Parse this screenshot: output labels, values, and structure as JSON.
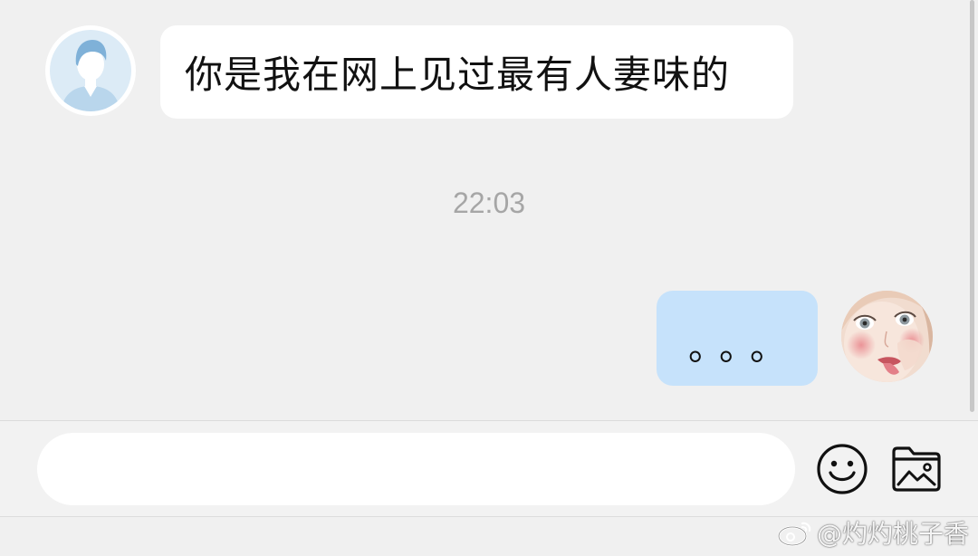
{
  "chat": {
    "messages": [
      {
        "direction": "incoming",
        "text": "你是我在网上见过最有人妻味的",
        "avatar": "default-person-icon"
      },
      {
        "direction": "outgoing",
        "text": "。。。",
        "avatar": "user-avatar-photo"
      }
    ],
    "timestamp": "22:03"
  },
  "input": {
    "value": "",
    "placeholder": ""
  },
  "toolbar": {
    "icons": [
      "emoji-icon",
      "image-folder-icon"
    ]
  },
  "watermark": {
    "text": "@灼灼桃子香"
  },
  "colors": {
    "background": "#f0f0f0",
    "incoming_bubble": "#ffffff",
    "outgoing_bubble": "#c6e2fb",
    "timestamp": "#a6a6a6"
  }
}
